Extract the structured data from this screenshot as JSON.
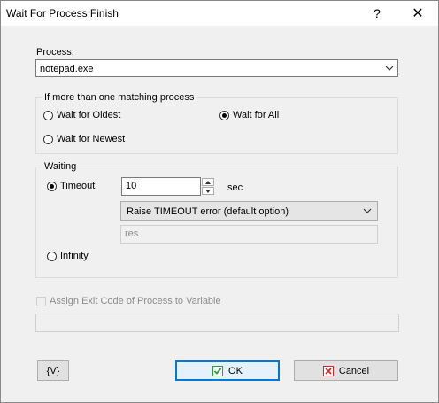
{
  "window": {
    "title": "Wait For Process Finish",
    "help_label": "?",
    "close_label": "✕"
  },
  "process": {
    "label": "Process:",
    "value": "notepad.exe"
  },
  "multiple": {
    "group_title": "If more than one matching process",
    "options": [
      {
        "label": "Wait for Oldest",
        "selected": false
      },
      {
        "label": "Wait for All",
        "selected": true
      },
      {
        "label": "Wait for Newest",
        "selected": false
      }
    ]
  },
  "waiting": {
    "group_title": "Waiting",
    "timeout_label": "Timeout",
    "timeout_selected": true,
    "timeout_value": "10",
    "unit_label": "sec",
    "error_option": "Raise TIMEOUT error (default option)",
    "result_var": "res",
    "infinity_label": "Infinity",
    "infinity_selected": false
  },
  "exit_code": {
    "label": "Assign Exit Code of Process to Variable",
    "checked": false,
    "enabled": false,
    "value": ""
  },
  "buttons": {
    "var_label": "{V}",
    "ok_label": "OK",
    "cancel_label": "Cancel"
  },
  "colors": {
    "ok_check": "#2e9e3a",
    "cancel_x": "#d4282a",
    "default_border": "#0078d7"
  },
  "icons": [
    "question-icon",
    "close-icon",
    "chevron-down-icon",
    "spin-up-icon",
    "spin-down-icon",
    "check-icon",
    "x-icon"
  ]
}
